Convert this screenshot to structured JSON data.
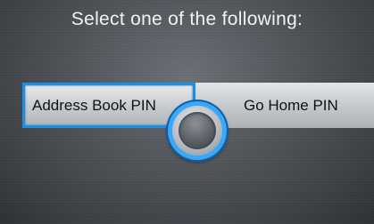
{
  "header": {
    "title": "Select one of the following:"
  },
  "options": [
    {
      "label": "Address Book PIN",
      "selected": true
    },
    {
      "label": "Go Home PIN",
      "selected": false
    }
  ],
  "colors": {
    "highlight": "#1d8fe3",
    "knob_ring": "#3aa8f4"
  },
  "icons": {
    "selector": "joystick-knob-icon"
  }
}
